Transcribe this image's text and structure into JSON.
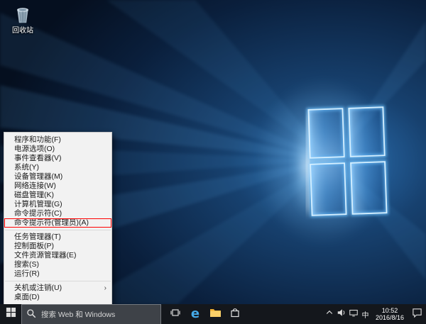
{
  "desktop": {
    "icons": [
      {
        "label": "回收站"
      }
    ]
  },
  "context_menu": {
    "items": [
      {
        "label": "程序和功能(F)"
      },
      {
        "label": "电源选项(O)"
      },
      {
        "label": "事件查看器(V)"
      },
      {
        "label": "系统(Y)"
      },
      {
        "label": "设备管理器(M)"
      },
      {
        "label": "网络连接(W)"
      },
      {
        "label": "磁盘管理(K)"
      },
      {
        "label": "计算机管理(G)"
      },
      {
        "label": "命令提示符(C)"
      },
      {
        "label": "命令提示符(管理员)(A)",
        "annotated": true
      },
      {
        "label": "任务管理器(T)"
      },
      {
        "label": "控制面板(P)"
      },
      {
        "label": "文件资源管理器(E)"
      },
      {
        "label": "搜索(S)"
      },
      {
        "label": "运行(R)"
      },
      {
        "label": "关机或注销(U)",
        "has_submenu": true,
        "submenu_arrow": "›"
      },
      {
        "label": "桌面(D)"
      }
    ]
  },
  "taskbar": {
    "search": {
      "placeholder": "搜索 Web 和 Windows"
    },
    "tray": {
      "time": "10:52",
      "date": "2016/8/16",
      "ime_indicator": "中"
    }
  },
  "colors": {
    "annotation_red": "#ff0000",
    "taskbar_bg": "#14171c",
    "menu_bg": "#f2f2f2",
    "wallpaper_deep": "#061222",
    "wallpaper_glow": "#2d74b8",
    "edge_blue": "#45aae8"
  }
}
